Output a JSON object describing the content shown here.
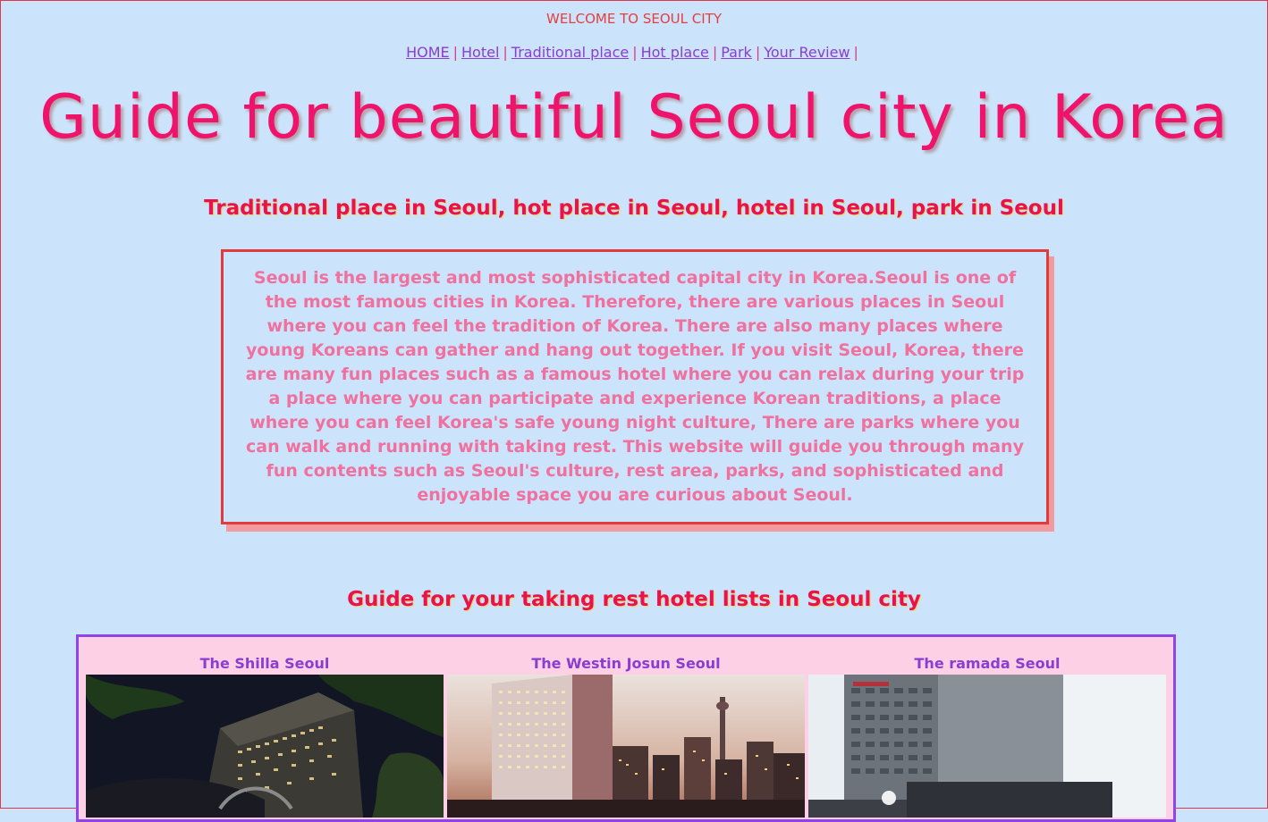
{
  "header": {
    "welcome": "WELCOME TO SEOUL CITY"
  },
  "nav": {
    "items": [
      "HOME",
      "Hotel",
      "Traditional place",
      "Hot place",
      "Park",
      "Your Review"
    ],
    "separator": "|"
  },
  "main": {
    "title": "Guide for beautiful Seoul city in Korea",
    "subtitle": "Traditional place in Seoul, hot place in Seoul, hotel in Seoul, park in Seoul",
    "intro": "Seoul is the largest and most sophisticated capital city in Korea.Seoul is one of the most famous cities in Korea. Therefore, there are various places in Seoul where you can feel the tradition of Korea. There are also many places where young Koreans can gather and hang out together. If you visit Seoul, Korea, there are many fun places such as a famous hotel where you can relax during your trip a place where you can participate and experience Korean traditions, a place where you can feel Korea's safe young night culture, There are parks where you can walk and running with taking rest. This website will guide you through many fun contents such as Seoul's culture, rest area, parks, and sophisticated and enjoyable space you are curious about Seoul."
  },
  "hotels": {
    "heading": "Guide for your taking rest hotel lists in Seoul city",
    "items": [
      {
        "name": "The Shilla Seoul"
      },
      {
        "name": "The Westin Josun Seoul"
      },
      {
        "name": "The ramada Seoul"
      }
    ]
  },
  "colors": {
    "background": "#cbe4fb",
    "title": "#f0136b",
    "subtitle": "#e8124e",
    "link": "#8a3dcf",
    "intro_text": "#f0709e",
    "intro_border": "#e23b3b",
    "hotel_border": "#8e44e8",
    "hotel_bg": "#fdd0e6"
  }
}
